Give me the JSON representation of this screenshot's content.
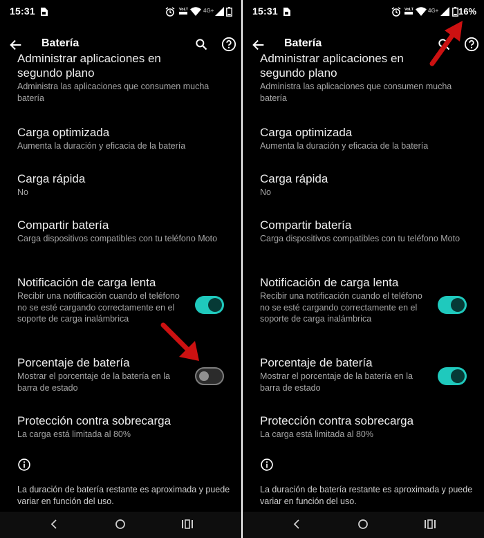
{
  "status": {
    "time": "15:31",
    "lte_label": "4G+",
    "battery_percent": "16%"
  },
  "appbar": {
    "title": "Batería"
  },
  "items": {
    "background": {
      "title_line1": "Administrar aplicaciones en",
      "title_line2": "segundo plano",
      "summary": "Administra las aplicaciones que consumen mucha batería"
    },
    "optimized": {
      "title": "Carga optimizada",
      "summary": "Aumenta la duración y eficacia de la batería"
    },
    "fast": {
      "title": "Carga rápida",
      "summary": "No"
    },
    "share": {
      "title": "Compartir batería",
      "summary": "Carga dispositivos compatibles con tu teléfono Moto"
    },
    "slow": {
      "title": "Notificación de carga lenta",
      "summary": "Recibir una notificación cuando el teléfono no se esté cargando correctamente en el soporte de carga inalámbrica"
    },
    "percentage": {
      "title": "Porcentaje de batería",
      "summary": "Mostrar el porcentaje de la batería en la barra de estado"
    },
    "overcharge": {
      "title": "Protección contra sobrecarga",
      "summary": "La carga está limitada al 80%"
    }
  },
  "footer": {
    "info": "La duración de batería restante es aproximada y puede variar en función del uso."
  },
  "toggles": {
    "left": {
      "slow_charge": true,
      "battery_percentage": false
    },
    "right": {
      "slow_charge": true,
      "battery_percentage": true
    }
  },
  "colors": {
    "accent": "#1fc9bd",
    "arrow": "#cc1111",
    "background": "#000000"
  }
}
